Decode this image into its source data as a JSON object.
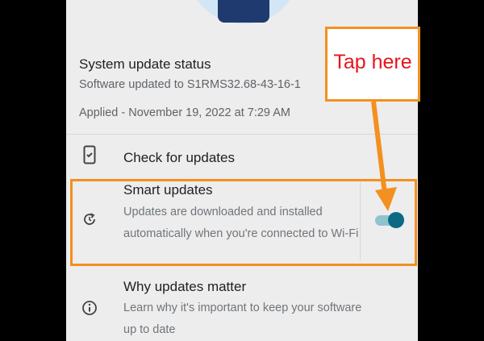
{
  "status": {
    "title": "System update status",
    "software": "Software updated to S1RMS32.68-43-16-1",
    "applied": "Applied - November 19, 2022 at 7:29 AM"
  },
  "rows": {
    "check": {
      "title": "Check for updates",
      "icon": "phone-update-icon"
    },
    "smart": {
      "title": "Smart updates",
      "desc": "Updates are downloaded and installed automatically when you're connected to Wi-Fi",
      "icon": "refresh-clock-icon",
      "toggle_on": true
    },
    "why": {
      "title": "Why updates matter",
      "desc": "Learn why it's important to keep your software up to date",
      "icon": "info-icon"
    }
  },
  "annotation": {
    "callout": "Tap here",
    "color": "#f39020",
    "text_color": "#e8141b"
  }
}
